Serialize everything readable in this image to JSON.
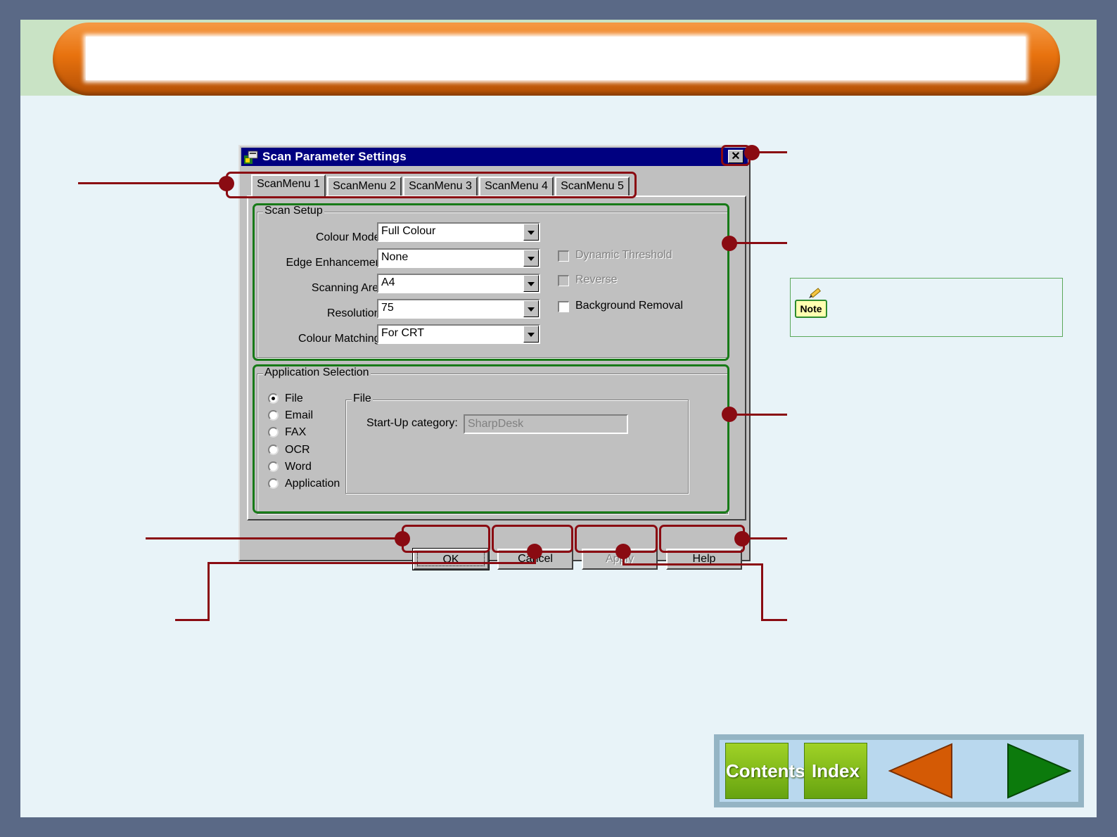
{
  "dialog": {
    "title": "Scan Parameter Settings",
    "close_symbol": "✕",
    "tabs": [
      {
        "label": "ScanMenu 1",
        "active": true
      },
      {
        "label": "ScanMenu 2",
        "active": false
      },
      {
        "label": "ScanMenu 3",
        "active": false
      },
      {
        "label": "ScanMenu 4",
        "active": false
      },
      {
        "label": "ScanMenu 5",
        "active": false
      }
    ],
    "scan_setup": {
      "group_label": "Scan Setup",
      "fields": [
        {
          "label": "Colour Mode:",
          "value": "Full Colour"
        },
        {
          "label": "Edge Enhancement",
          "value": "None"
        },
        {
          "label": "Scanning Area",
          "value": "A4"
        },
        {
          "label": "Resolution:",
          "value": "75"
        },
        {
          "label": "Colour Matching:",
          "value": "For CRT"
        }
      ],
      "checkboxes": [
        {
          "label": "Dynamic Threshold",
          "checked": false,
          "enabled": false
        },
        {
          "label": "Reverse",
          "checked": false,
          "enabled": false
        },
        {
          "label": "Background Removal",
          "checked": false,
          "enabled": true
        }
      ]
    },
    "application_selection": {
      "group_label": "Application Selection",
      "options": [
        {
          "label": "File",
          "selected": true
        },
        {
          "label": "Email",
          "selected": false
        },
        {
          "label": "FAX",
          "selected": false
        },
        {
          "label": "OCR",
          "selected": false
        },
        {
          "label": "Word",
          "selected": false
        },
        {
          "label": "Application",
          "selected": false
        }
      ],
      "file_group_label": "File",
      "startup_label": "Start-Up category:",
      "startup_value": "SharpDesk"
    },
    "buttons": {
      "ok": "OK",
      "cancel": "Cancel",
      "apply": "Apply",
      "help": "Help"
    }
  },
  "note": {
    "icon_label": "Note"
  },
  "nav": {
    "contents": "Contents",
    "index": "Index",
    "prev_icon": "left-arrow-icon",
    "next_icon": "right-arrow-icon"
  },
  "colors": {
    "callout": "#8a0b12",
    "group_highlight": "#177a17",
    "header_orange": "#e8720e",
    "nav_green": "#66a310"
  }
}
